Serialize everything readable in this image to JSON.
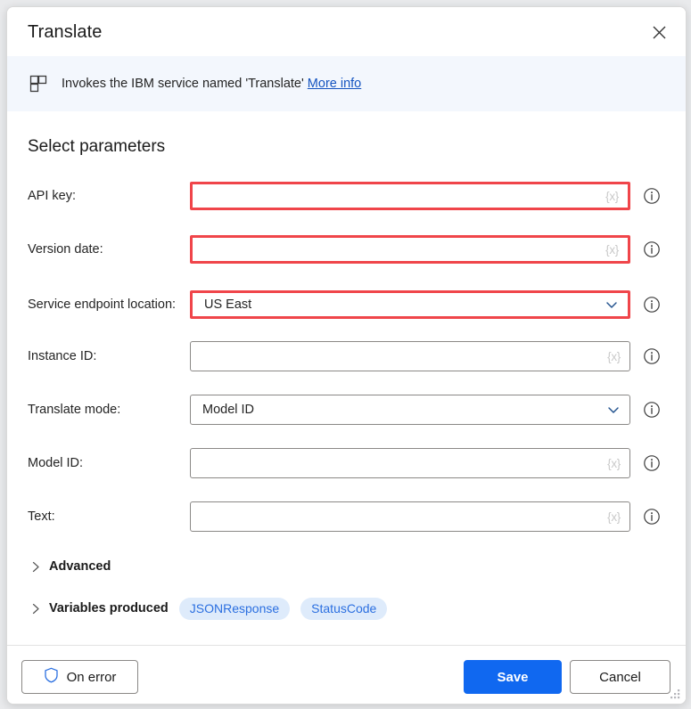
{
  "window": {
    "title": "Translate",
    "close_icon": "close-icon",
    "resize_grip": "resize-grip"
  },
  "banner": {
    "icon": "module-icon",
    "text": "Invokes the IBM service named 'Translate'",
    "link_label": "More info"
  },
  "main": {
    "section_title": "Select parameters",
    "variable_glyph": "{x}",
    "info_icon": "info-icon",
    "fields": [
      {
        "label": "API key:",
        "type": "text",
        "value": "",
        "error": true,
        "has_variable_glyph": true,
        "info": "info-icon"
      },
      {
        "label": "Version date:",
        "type": "text",
        "value": "",
        "error": true,
        "has_variable_glyph": true,
        "info": "info-icon"
      },
      {
        "label": "Service endpoint location:",
        "type": "dropdown",
        "value": "US East",
        "error": true,
        "has_variable_glyph": false,
        "info": "info-icon"
      },
      {
        "label": "Instance ID:",
        "type": "text",
        "value": "",
        "error": false,
        "has_variable_glyph": true,
        "info": "info-icon"
      },
      {
        "label": "Translate mode:",
        "type": "dropdown",
        "value": "Model ID",
        "error": false,
        "has_variable_glyph": false,
        "info": "info-icon"
      },
      {
        "label": "Model ID:",
        "type": "text",
        "value": "",
        "error": false,
        "has_variable_glyph": true,
        "info": "info-icon"
      },
      {
        "label": "Text:",
        "type": "text",
        "value": "",
        "error": false,
        "has_variable_glyph": true,
        "info": "info-icon"
      }
    ],
    "advanced": {
      "label": "Advanced",
      "expanded": false,
      "chevron_icon": "chevron-right-icon"
    },
    "variables_produced": {
      "label": "Variables produced",
      "expanded": false,
      "chevron_icon": "chevron-right-icon",
      "items": [
        "JSONResponse",
        "StatusCode"
      ]
    }
  },
  "footer": {
    "on_error_label": "On error",
    "on_error_icon": "shield-icon",
    "save_label": "Save",
    "cancel_label": "Cancel"
  },
  "colors": {
    "accent": "#1068f0",
    "error": "#f0454a",
    "link": "#1554c0",
    "banner_bg": "#f3f7fd",
    "pill_bg": "#deebfb",
    "pill_text": "#2b6fe0"
  }
}
